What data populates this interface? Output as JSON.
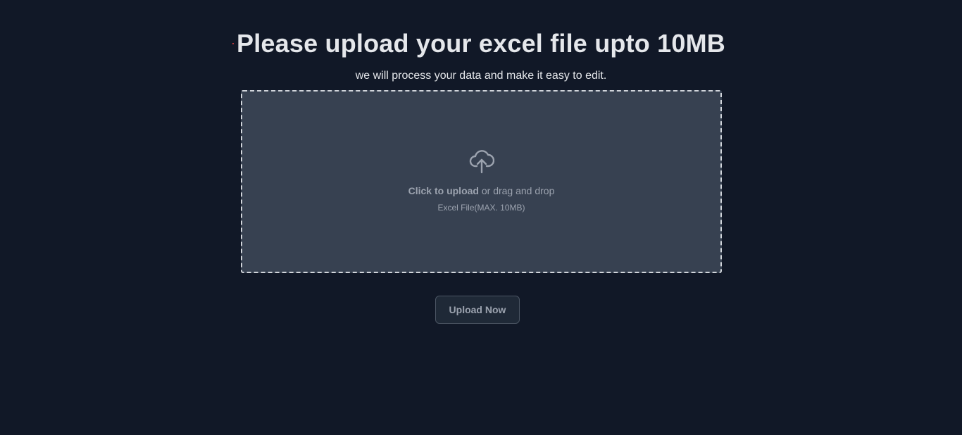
{
  "header": {
    "title": "Please upload your excel file upto 10MB",
    "subtitle": "we will process your data and make it easy to edit.",
    "marker_color": "#ef4444"
  },
  "dropzone": {
    "icon": "cloud-upload-icon",
    "click_label": "Click to upload",
    "drag_label": " or drag and drop",
    "hint": "Excel File(MAX. 10MB)"
  },
  "actions": {
    "upload_label": "Upload Now"
  },
  "colors": {
    "background": "#111827",
    "dropzone_bg": "#374151",
    "text_primary": "#e5e7eb",
    "text_muted": "#9ca3af"
  }
}
